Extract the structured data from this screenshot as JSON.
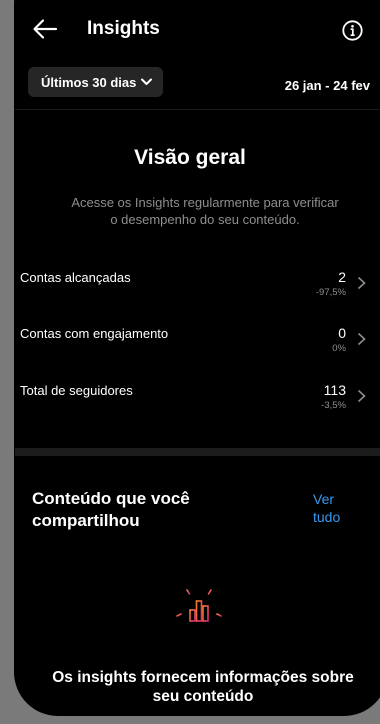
{
  "header": {
    "title": "Insights",
    "back_icon": "arrow-left-icon",
    "info_icon": "info-icon"
  },
  "filter": {
    "period_label": "Últimos 30 dias",
    "date_range": "26 jan - 24 fev"
  },
  "overview": {
    "title": "Visão geral",
    "description": "Acesse os Insights regularmente para verificar o desempenho do seu conteúdo."
  },
  "metrics": [
    {
      "label": "Contas alcançadas",
      "value": "2",
      "change": "-97,5%"
    },
    {
      "label": "Contas com engajamento",
      "value": "0",
      "change": "0%"
    },
    {
      "label": "Total de seguidores",
      "value": "113",
      "change": "-3,5%"
    }
  ],
  "shared_content": {
    "title": "Conteúdo que você compartilhou",
    "see_all": "Ver tudo"
  },
  "empty_state": {
    "icon": "insights-chart-icon",
    "message": "Os insights fornecem informações sobre seu conteúdo"
  },
  "colors": {
    "background": "#000000",
    "link": "#3797f0",
    "pill": "#262626",
    "muted_text": "#8e8e8e",
    "icon_gradient": [
      "#f58529",
      "#dd2a7b"
    ]
  }
}
